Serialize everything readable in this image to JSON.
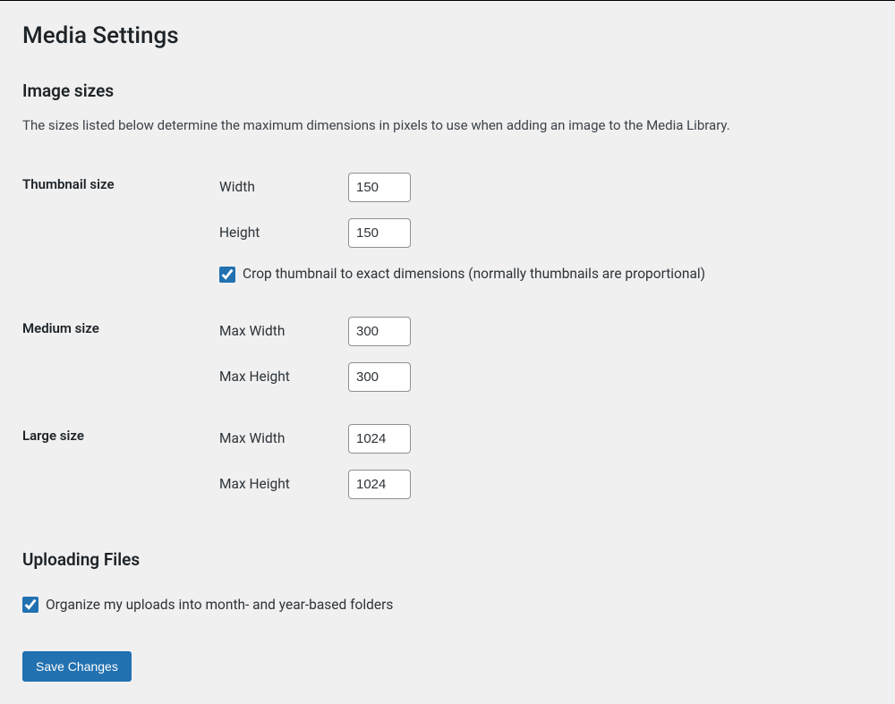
{
  "page": {
    "title": "Media Settings"
  },
  "image_sizes": {
    "heading": "Image sizes",
    "description": "The sizes listed below determine the maximum dimensions in pixels to use when adding an image to the Media Library.",
    "thumbnail": {
      "label": "Thumbnail size",
      "width_label": "Width",
      "width_value": "150",
      "height_label": "Height",
      "height_value": "150",
      "crop_label": "Crop thumbnail to exact dimensions (normally thumbnails are proportional)",
      "crop_checked": true
    },
    "medium": {
      "label": "Medium size",
      "width_label": "Max Width",
      "width_value": "300",
      "height_label": "Max Height",
      "height_value": "300"
    },
    "large": {
      "label": "Large size",
      "width_label": "Max Width",
      "width_value": "1024",
      "height_label": "Max Height",
      "height_value": "1024"
    }
  },
  "uploading_files": {
    "heading": "Uploading Files",
    "organize_label": "Organize my uploads into month- and year-based folders",
    "organize_checked": true
  },
  "actions": {
    "save_label": "Save Changes"
  }
}
